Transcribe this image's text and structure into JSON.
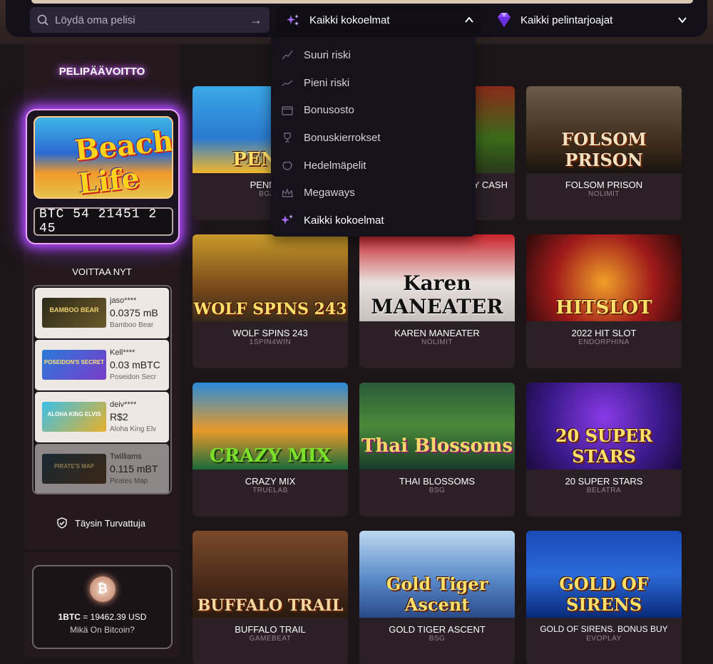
{
  "header": {
    "search_placeholder": "Löydä oma pelisi",
    "search_submit_icon": "arrow-right-icon",
    "collection_selected": "Kaikki kokoelmat",
    "provider_selected": "Kaikki pelintarjoajat"
  },
  "collections_menu": {
    "items": [
      {
        "label": "Suuri riski",
        "icon": "high-risk-icon"
      },
      {
        "label": "Pieni riski",
        "icon": "low-risk-icon"
      },
      {
        "label": "Bonusosto",
        "icon": "bonus-buy-icon"
      },
      {
        "label": "Bonuskierrokset",
        "icon": "trophy-icon"
      },
      {
        "label": "Hedelmäpelit",
        "icon": "fruit-icon"
      },
      {
        "label": "Megaways",
        "icon": "crown-icon"
      },
      {
        "label": "Kaikki kokoelmat",
        "icon": "sparkles-icon"
      }
    ]
  },
  "sidebar": {
    "jackpot_title": "PELIPÄÄVOITTO",
    "jackpot_game_logo": "Beach Life",
    "jackpot_counter": "BTC 54 21451 2 45",
    "winners_title": "VOITTAA NYT",
    "winners": [
      {
        "user": "jaso****",
        "amount": "0.0375 mB",
        "game": "Bamboo Bear",
        "thumb_text": "BAMBOO BEAR"
      },
      {
        "user": "Kell****",
        "amount": "0.03 mBTC",
        "game": "Poseidon Secr",
        "thumb_text": "POSEIDON'S SECRET"
      },
      {
        "user": "deiv****",
        "amount": "R$2",
        "game": "Aloha King Elv",
        "thumb_text": "ALOHA KING ELVIS"
      },
      {
        "user": "Twilliams",
        "amount": "0.115 mBT",
        "game": "Pirates Map",
        "thumb_text": "PIRATE'S MAP"
      }
    ],
    "secure_label": "Täysin Turvattuja",
    "btc_rate_prefix": "1BTC",
    "btc_rate_value": " = 19462.39 USD",
    "btc_link": "Mikä On Bitcoin?",
    "btc_coin_symbol": "₿"
  },
  "games": [
    {
      "name": "PENNY P",
      "provider": "BGAM",
      "art_title": "PENNY"
    },
    {
      "name": "Y CASH",
      "provider": "",
      "art_title": ""
    },
    {
      "name": "FOLSOM PRISON",
      "provider": "NOLIMIT",
      "art_title": "FOLSOM PRISON"
    },
    {
      "name": "WOLF SPINS 243",
      "provider": "1SPIN4WIN",
      "art_title": "WOLF SPINS 243"
    },
    {
      "name": "KAREN MANEATER",
      "provider": "NOLIMIT",
      "art_title": "Karen MANEATER"
    },
    {
      "name": "2022 HIT SLOT",
      "provider": "ENDORPHINA",
      "art_title": "HITSLOT"
    },
    {
      "name": "CRAZY MIX",
      "provider": "TRUELAB",
      "art_title": "CRAZY MIX"
    },
    {
      "name": "THAI BLOSSOMS",
      "provider": "BSG",
      "art_title": "Thai Blossoms"
    },
    {
      "name": "20 SUPER STARS",
      "provider": "BELATRA",
      "art_title": "20 SUPER STARS"
    },
    {
      "name": "BUFFALO TRAIL",
      "provider": "GAMEBEAT",
      "art_title": "BUFFALO TRAIL"
    },
    {
      "name": "GOLD TIGER ASCENT",
      "provider": "BSG",
      "art_title": "Gold Tiger Ascent"
    },
    {
      "name": "GOLD OF SIRENS. BONUS BUY",
      "provider": "EVOPLAY",
      "art_title": "GOLD OF SIRENS"
    }
  ],
  "colors": {
    "background": "#1c1618",
    "accent_purple": "#b04cff",
    "card": "#2a2026"
  }
}
